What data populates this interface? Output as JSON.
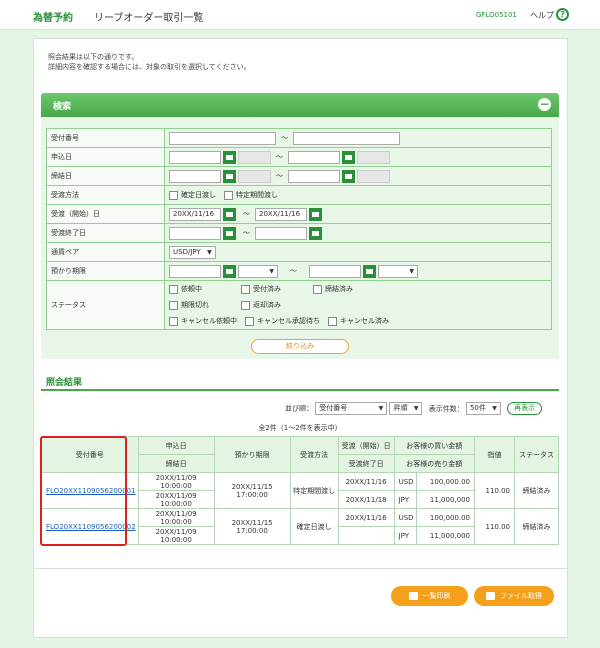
{
  "header": {
    "brand": "為替予約",
    "title": "リーブオーダー取引一覧",
    "screen_id": "GFLO05101",
    "help": "ヘルプ",
    "help_icon": "?"
  },
  "intro": {
    "line1": "照会結果は以下の通りです。",
    "line2": "詳細内容を確認する場合には、対象の取引を選択してください。"
  },
  "search": {
    "title": "検索",
    "collapse_icon": "−",
    "tilde": "～",
    "rows": {
      "receipt_no": "受付番号",
      "apply_date": "申込日",
      "contract_date": "締結日",
      "delivery_method": "受渡方法",
      "delivery_start": "受渡（開始）日",
      "delivery_end": "受渡終了日",
      "currency_pair": "通貨ペア",
      "expiry": "預かり期限",
      "status": "ステータス"
    },
    "delivery_options": [
      "確定日渡し",
      "特定期間渡し"
    ],
    "delivery_start_from": "20XX/11/16",
    "delivery_start_to": "20XX/11/16",
    "currency_value": "USD/JPY",
    "status_options": [
      "依頼中",
      "受付済み",
      "締結済み",
      "期限切れ",
      "返却済み",
      "キャンセル依頼中",
      "キャンセル承認待ち",
      "キャンセル済み"
    ],
    "narrow_button": "絞り込み"
  },
  "results": {
    "title": "照会結果",
    "sort_label": "並び順：",
    "sort_value": "受付番号",
    "order_value": "昇順",
    "per_page_label": "表示件数：",
    "per_page_value": "50件",
    "redisplay": "再表示",
    "count": "全2件（1～2件を表示中）",
    "headers": {
      "receipt_no": "受付番号",
      "apply_date": "申込日",
      "contract_date": "締結日",
      "expiry": "預かり期限",
      "delivery_method": "受渡方法",
      "delivery_start": "受渡（開始）日",
      "delivery_end": "受渡終了日",
      "buy_amount": "お客様の買い金額",
      "sell_amount": "お客様の売り金額",
      "price": "指値",
      "status": "ステータス"
    },
    "rows": [
      {
        "receipt_no": "FLO20XX1109056200001",
        "apply_date": "20XX/11/09 10:00:00",
        "contract_date": "20XX/11/09 10:00:00",
        "expiry": "20XX/11/15 17:00:00",
        "delivery_method": "特定期間渡し",
        "delivery_start": "20XX/11/16",
        "delivery_end": "20XX/11/18",
        "buy_ccy": "USD",
        "buy_amt": "100,000.00",
        "sell_ccy": "JPY",
        "sell_amt": "11,000,000",
        "price": "110.00",
        "status": "締結済み"
      },
      {
        "receipt_no": "FLO20XX1109056200002",
        "apply_date": "20XX/11/09 10:00:00",
        "contract_date": "20XX/11/09 10:00:00",
        "expiry": "20XX/11/15 17:00:00",
        "delivery_method": "確定日渡し",
        "delivery_start": "20XX/11/16",
        "delivery_end": "",
        "buy_ccy": "USD",
        "buy_amt": "100,000.00",
        "sell_ccy": "JPY",
        "sell_amt": "11,000,000",
        "price": "110.00",
        "status": "締結済み"
      }
    ]
  },
  "footer": {
    "print_button": "一覧印刷",
    "file_button": "ファイル取得"
  }
}
